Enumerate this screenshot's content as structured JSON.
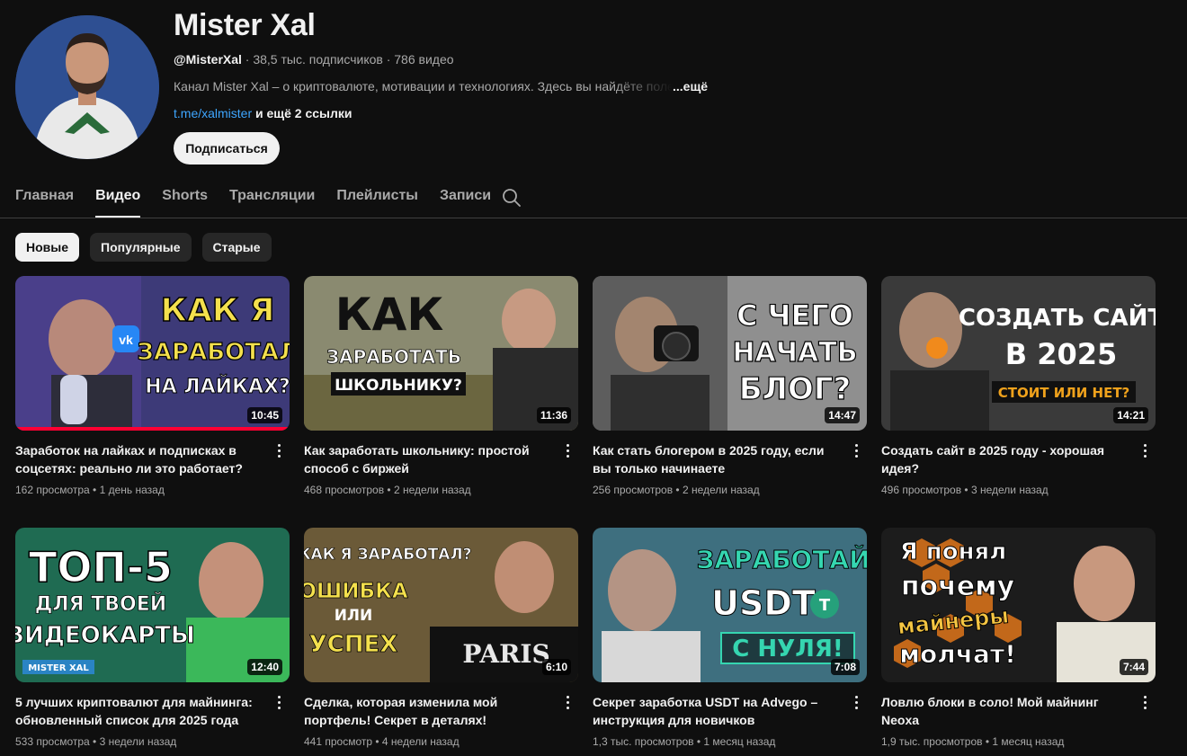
{
  "channel": {
    "name": "Mister Xal",
    "handle": "@MisterXal",
    "stats": " · 38,5 тыс. подписчиков · 786 видео",
    "description": "Канал Mister Xal – о криптовалюте, мотивации и технологиях. Здесь вы найдёте полезную информацию",
    "description_more": "...ещё",
    "link": "t.me/xalmister",
    "more_links": " и ещё 2 ссылки",
    "subscribe_label": "Подписаться"
  },
  "tabs": [
    {
      "label": "Главная",
      "active": false
    },
    {
      "label": "Видео",
      "active": true
    },
    {
      "label": "Shorts",
      "active": false
    },
    {
      "label": "Трансляции",
      "active": false
    },
    {
      "label": "Плейлисты",
      "active": false
    },
    {
      "label": "Записи",
      "active": false
    }
  ],
  "chips": [
    {
      "label": "Новые",
      "active": true
    },
    {
      "label": "Популярные",
      "active": false
    },
    {
      "label": "Старые",
      "active": false
    }
  ],
  "colors": {
    "accent_red": "#ff0033",
    "link_blue": "#3ea6ff",
    "background": "#0f0f0f"
  },
  "videos": [
    {
      "title": "Заработок на лайках и подписках в соцсетях: реально ли это работает?",
      "views": "162 просмотра",
      "age": "1 день назад",
      "duration": "10:45",
      "thumb_lines": [
        "КАК Я",
        "ЗАРАБОТАЛ",
        "НА ЛАЙКАХ?"
      ],
      "watched_fraction": 1.0
    },
    {
      "title": "Как заработать школьнику: простой способ с биржей",
      "views": "468 просмотров",
      "age": "2 недели назад",
      "duration": "11:36",
      "thumb_lines": [
        "КАК",
        "ЗАРАБОТАТЬ",
        "ШКОЛЬНИКУ?"
      ]
    },
    {
      "title": "Как стать блогером в 2025 году, если вы только начинаете",
      "views": "256 просмотров",
      "age": "2 недели назад",
      "duration": "14:47",
      "thumb_lines": [
        "С ЧЕГО",
        "НАЧАТЬ",
        "БЛОГ?"
      ]
    },
    {
      "title": "Создать сайт в 2025 году - хорошая идея?",
      "views": "496 просмотров",
      "age": "3 недели назад",
      "duration": "14:21",
      "thumb_lines": [
        "СОЗДАТЬ САЙТ",
        "В 2025",
        "СТОИТ ИЛИ НЕТ?"
      ]
    },
    {
      "title": "5 лучших криптовалют для майнинга: обновленный список для 2025 года",
      "views": "533 просмотра",
      "age": "3 недели назад",
      "duration": "12:40",
      "thumb_lines": [
        "ТОП-5",
        "ДЛЯ ТВОЕЙ",
        "ВИДЕОКАРТЫ",
        "MISTER XAL"
      ]
    },
    {
      "title": "Сделка, которая изменила мой портфель! Секрет в деталях!",
      "views": "441 просмотр",
      "age": "4 недели назад",
      "duration": "6:10",
      "thumb_lines": [
        "КАК Я ЗАРАБОТАЛ?",
        "ОШИБКА",
        "ИЛИ",
        "УСПЕХ",
        "PARIS"
      ]
    },
    {
      "title": "Секрет заработка USDT на Advego – инструкция для новичков",
      "views": "1,3 тыс. просмотров",
      "age": "1 месяц назад",
      "duration": "7:08",
      "thumb_lines": [
        "ЗАРАБОТАЙ",
        "USDT",
        "С НУЛЯ!"
      ]
    },
    {
      "title": "Ловлю блоки в соло! Мой майнинг Neoxa",
      "views": "1,9 тыс. просмотров",
      "age": "1 месяц назад",
      "duration": "7:44",
      "thumb_lines": [
        "Я понял",
        "почему",
        "майнеры",
        "молчат!"
      ]
    }
  ]
}
